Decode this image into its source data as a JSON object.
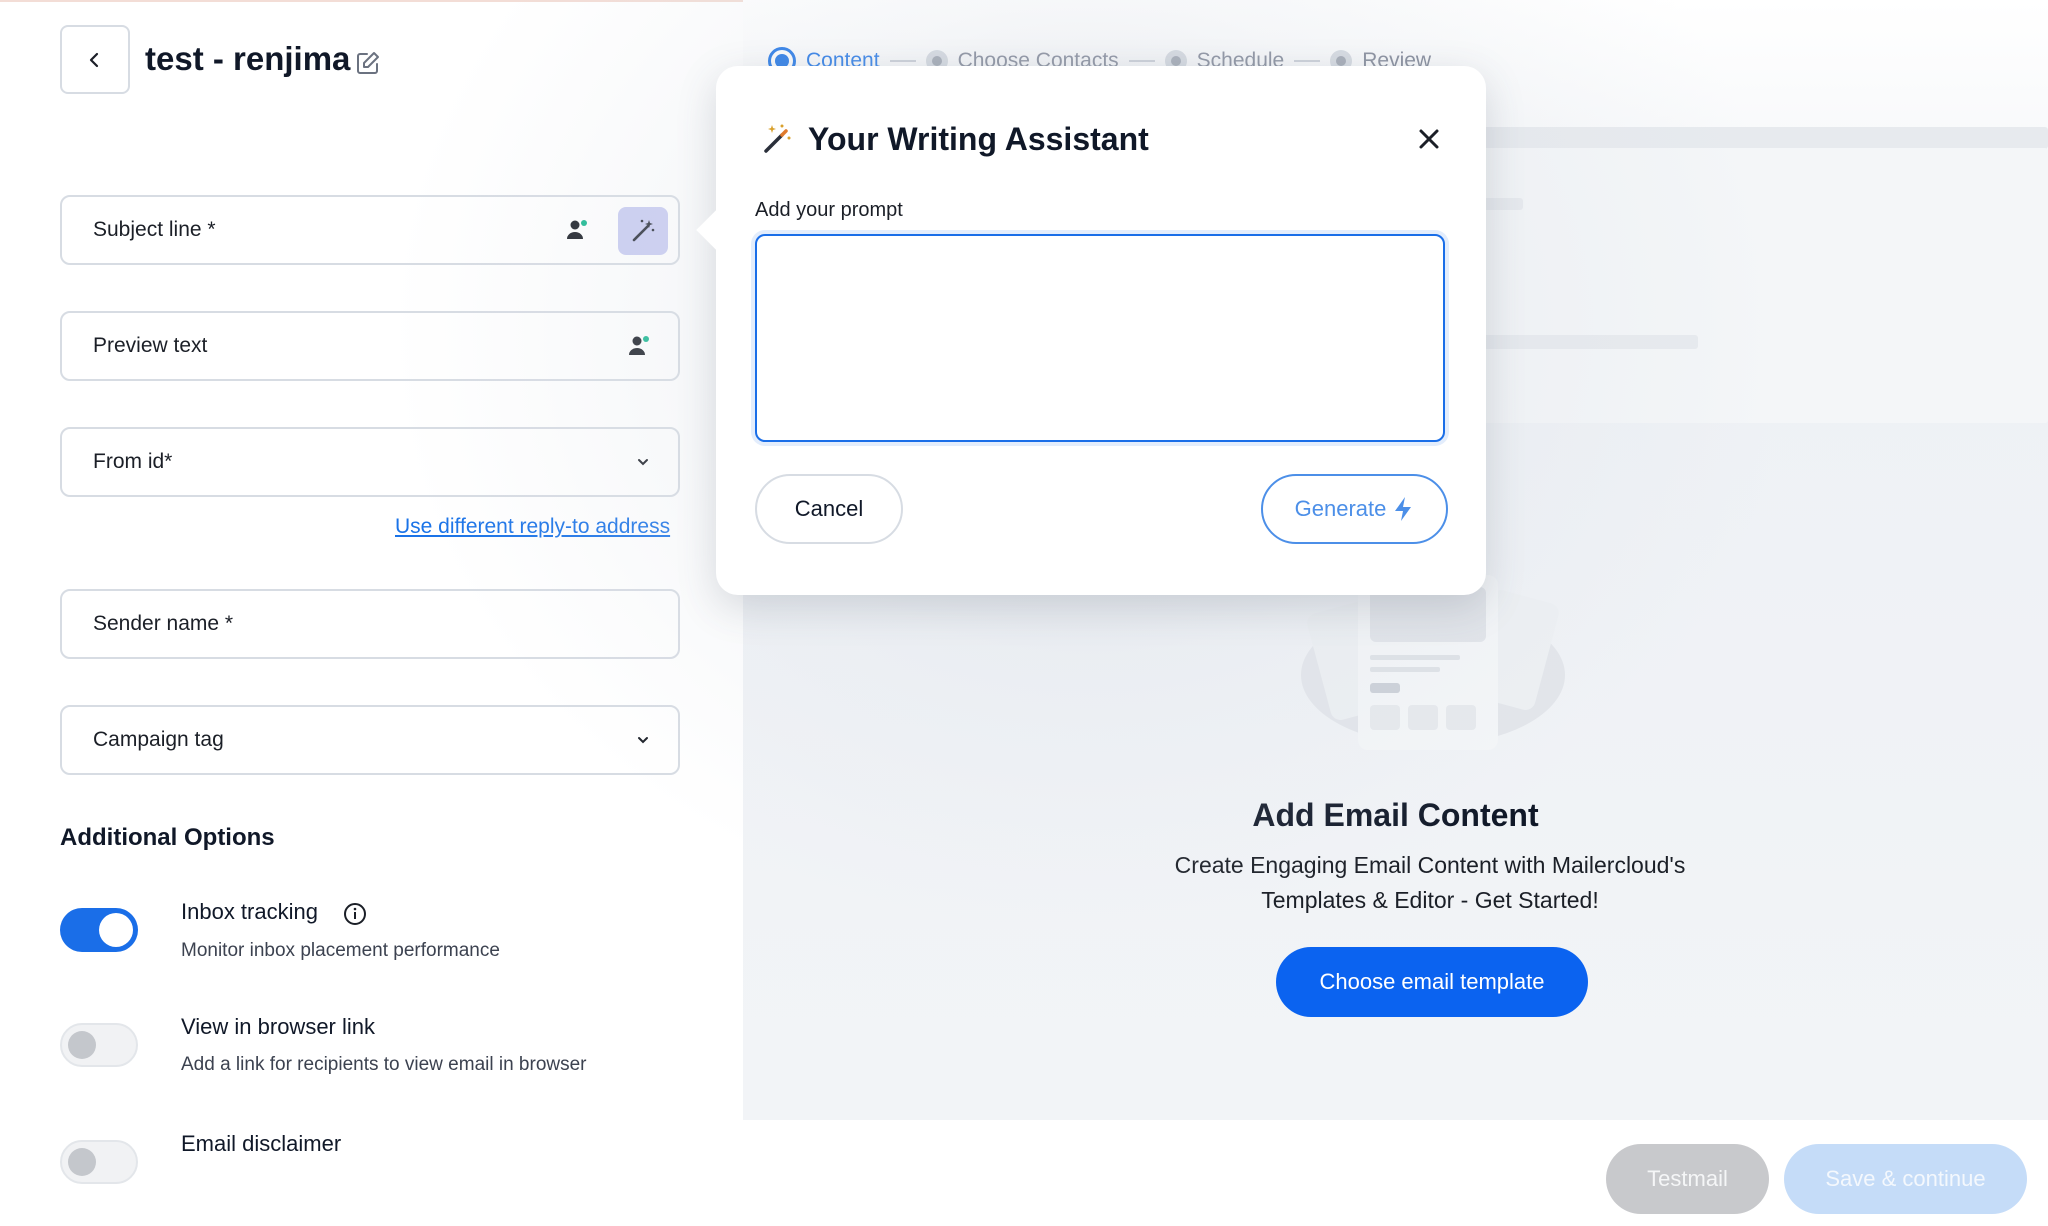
{
  "header": {
    "title": "test - renjima",
    "steps": [
      "Content",
      "Choose Contacts",
      "Schedule",
      "Review"
    ]
  },
  "form": {
    "subject_label": "Subject line *",
    "preview_label": "Preview text",
    "from_label": "From id*",
    "reply_link": "Use different reply-to address",
    "sender_label": "Sender name *",
    "tag_label": "Campaign tag"
  },
  "options": {
    "title": "Additional Options",
    "items": [
      {
        "title": "Inbox tracking",
        "desc": "Monitor inbox placement performance",
        "enabled": true
      },
      {
        "title": "View in browser link",
        "desc": "Add a link for recipients to view email in browser",
        "enabled": false
      },
      {
        "title": "Email disclaimer",
        "desc": "",
        "enabled": false
      }
    ]
  },
  "content": {
    "empty_title": "Add Email Content",
    "empty_sub": "Create Engaging Email Content with Mailercloud's Templates & Editor - Get Started!",
    "choose_button": "Choose email template"
  },
  "footer": {
    "testmail": "Testmail",
    "save": "Save & continue"
  },
  "modal": {
    "title": "Your Writing Assistant",
    "prompt_label": "Add your prompt",
    "prompt_value": "",
    "cancel": "Cancel",
    "generate": "Generate"
  },
  "colors": {
    "primary": "#0b63f0",
    "toggle_on": "#1a6ee8",
    "link": "#1a73e8",
    "magic_bg": "#c9ccf2"
  }
}
